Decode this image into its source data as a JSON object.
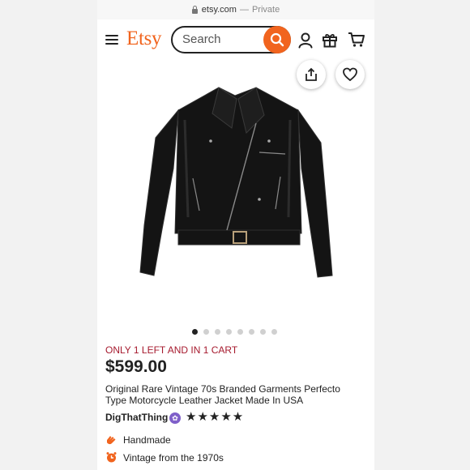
{
  "browser": {
    "url": "etsy.com",
    "separator": "—",
    "mode": "Private"
  },
  "header": {
    "logo": "Etsy",
    "search_placeholder": "Search"
  },
  "gallery": {
    "image_count": 8,
    "active_index": 0
  },
  "product": {
    "stock_message": "ONLY 1 LEFT AND IN 1 CART",
    "price": "$599.00",
    "title": "Original Rare Vintage 70s Branded Garments Perfecto Type Motorcycle Leather Jacket Made In USA",
    "shop_name": "DigThatThing",
    "star_seller_badge": "✿",
    "rating": 5,
    "rating_stars": "★★★★★"
  },
  "features": [
    {
      "icon": "hand-icon",
      "label": "Handmade"
    },
    {
      "icon": "clock-icon",
      "label": "Vintage from the 1970s"
    }
  ],
  "colors": {
    "accent": "#f1641e",
    "stock": "#a61a2e",
    "star_seller": "#7f5fc9"
  }
}
